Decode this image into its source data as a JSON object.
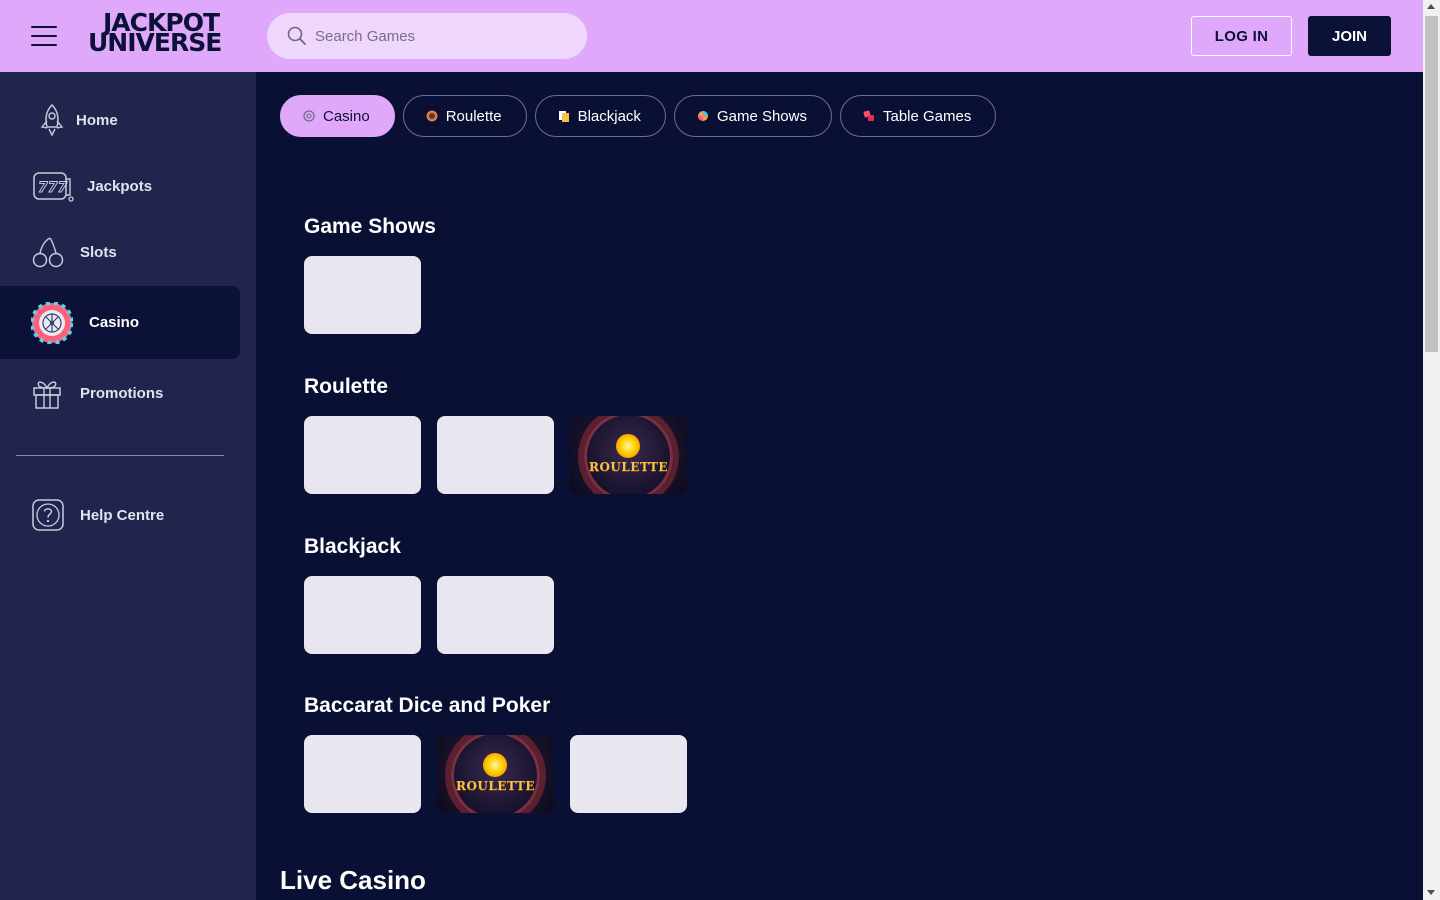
{
  "header": {
    "logo_line1": "JACKPOT",
    "logo_line2": "UNIVERSE",
    "search_placeholder": "Search Games",
    "login_label": "LOG IN",
    "join_label": "JOIN"
  },
  "sidebar": {
    "items": [
      {
        "label": "Home",
        "icon": "rocket-icon"
      },
      {
        "label": "Jackpots",
        "icon": "slot-machine-777-icon"
      },
      {
        "label": "Slots",
        "icon": "cherries-icon"
      },
      {
        "label": "Casino",
        "icon": "roulette-wheel-icon",
        "active": true
      },
      {
        "label": "Promotions",
        "icon": "gift-icon"
      }
    ],
    "help_label": "Help Centre"
  },
  "tabs": [
    {
      "label": "Casino",
      "active": true
    },
    {
      "label": "Roulette"
    },
    {
      "label": "Blackjack"
    },
    {
      "label": "Game Shows"
    },
    {
      "label": "Table Games"
    }
  ],
  "sections": [
    {
      "title": "Game Shows"
    },
    {
      "title": "Roulette",
      "tile_text": "ROULETTE"
    },
    {
      "title": "Blackjack"
    },
    {
      "title": "Baccarat Dice and Poker",
      "tile_text": "ROULETTE"
    }
  ],
  "live_title": "Live Casino",
  "colors": {
    "header_bg": "#e0a8fa",
    "sidebar_bg": "#21244d",
    "main_bg": "#0a1034",
    "accent_dark": "#0b1137"
  }
}
